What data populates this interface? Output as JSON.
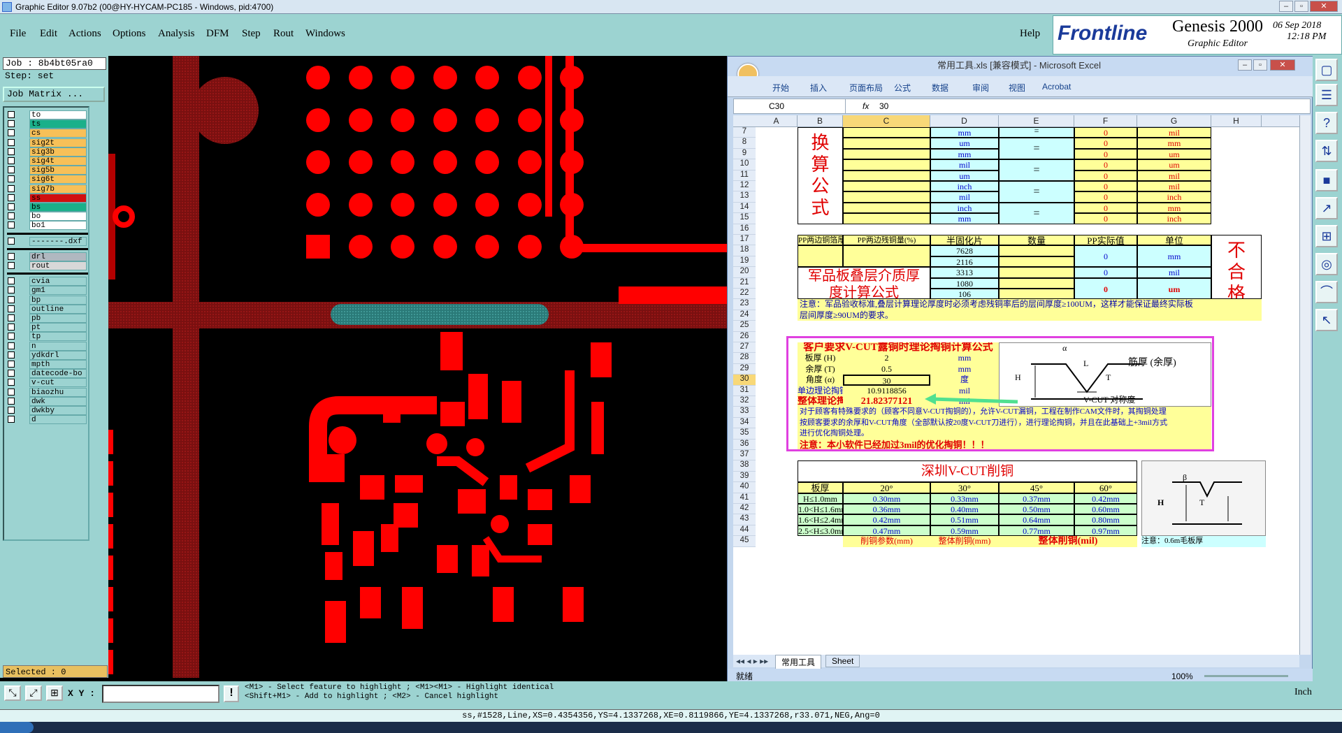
{
  "window": {
    "title": "Graphic Editor 9.07b2 (00@HY-HYCAM-PC185 - Windows, pid:4700)",
    "min": "–",
    "max": "▫",
    "close": "✕"
  },
  "menu": {
    "items": [
      "File",
      "Edit",
      "Actions",
      "Options",
      "Analysis",
      "DFM",
      "Step",
      "Rout",
      "Windows"
    ],
    "help": "Help"
  },
  "brand": {
    "logo": "Frontline",
    "product": "Genesis 2000",
    "subtitle": "Graphic Editor",
    "date": "06 Sep 2018",
    "time": "12:18 PM"
  },
  "job": {
    "job": "Job : 8b4bt05ra0",
    "step": "Step: set",
    "matrix_button": "Job Matrix ..."
  },
  "layers": [
    {
      "name": "to",
      "color": "#ffffff"
    },
    {
      "name": "ts",
      "color": "#1ab08a"
    },
    {
      "name": "cs",
      "color": "#f7c058"
    },
    {
      "name": "sig2t",
      "color": "#f7c058"
    },
    {
      "name": "sig3b",
      "color": "#f7c058"
    },
    {
      "name": "sig4t",
      "color": "#f7c058"
    },
    {
      "name": "sig5b",
      "color": "#f7c058"
    },
    {
      "name": "sig6t",
      "color": "#f7c058"
    },
    {
      "name": "sig7b",
      "color": "#f7c058"
    },
    {
      "name": "ss",
      "color": "#d01010"
    },
    {
      "name": "bs",
      "color": "#1ab08a"
    },
    {
      "name": "bo",
      "color": "#ffffff"
    },
    {
      "name": "bo1",
      "color": "#ffffff"
    }
  ],
  "layers_doc": [
    {
      "name": "-------.dxf",
      "color": "#9cd3d1"
    }
  ],
  "layers_drill": [
    {
      "name": "drl",
      "color": "#b0b8c0"
    },
    {
      "name": "rout",
      "color": "#d8d8d8"
    }
  ],
  "layers_misc": [
    "cvia",
    "gm1",
    "bp",
    "outline",
    "pb",
    "pt",
    "tp",
    "n",
    "ydkdrl",
    "mpth",
    "datecode-bo",
    "v-cut",
    "biaozhu",
    "dwk",
    "dwkby",
    "d"
  ],
  "selected": "Selected : 0",
  "xy": {
    "label": "X Y :",
    "value": ""
  },
  "hints": {
    "line1": "<M1> - Select feature to highlight ; <M1><M1> - Highlight identical",
    "line2": "<Shift+M1> - Add to highlight ; <M2> - Cancel highlight"
  },
  "units": "Inch",
  "status": "ss,#1528,Line,XS=0.4354356,YS=4.1337268,XE=0.8119866,YE=4.1337268,r33.071,NEG,Ang=0",
  "excel": {
    "title": "常用工具.xls  [兼容模式] - Microsoft Excel",
    "tabs": [
      "开始",
      "插入",
      "页面布局",
      "公式",
      "数据",
      "审阅",
      "视图",
      "Acrobat"
    ],
    "namebox": "C30",
    "fx": "fx",
    "formula_value": "30",
    "columns": [
      "A",
      "B",
      "C",
      "D",
      "E",
      "F",
      "G",
      "H"
    ],
    "rows": [
      "7",
      "8",
      "9",
      "10",
      "11",
      "12",
      "13",
      "14",
      "15",
      "16",
      "17",
      "18",
      "19",
      "20",
      "21",
      "22",
      "23",
      "24",
      "25",
      "26",
      "27",
      "28",
      "29",
      "30",
      "31",
      "32",
      "33",
      "34",
      "35",
      "36",
      "37",
      "38",
      "39",
      "40",
      "41",
      "42",
      "43",
      "44",
      "45"
    ],
    "conv_title": [
      "换",
      "算",
      "公",
      "式"
    ],
    "conv": [
      {
        "d": "mm",
        "e": "=",
        "f": "0",
        "g": "mil"
      },
      {
        "d": "um",
        "e": "",
        "f": "0",
        "g": "mm"
      },
      {
        "d": "mm",
        "e": "",
        "f": "0",
        "g": "um"
      },
      {
        "d": "mil",
        "e": "",
        "f": "0",
        "g": "um"
      },
      {
        "d": "um",
        "e": "",
        "f": "0",
        "g": "mil"
      },
      {
        "d": "inch",
        "e": "",
        "f": "0",
        "g": "mil"
      },
      {
        "d": "mil",
        "e": "",
        "f": "0",
        "g": "inch"
      },
      {
        "d": "inch",
        "e": "",
        "f": "0",
        "g": "mm"
      },
      {
        "d": "mm",
        "e": "",
        "f": "0",
        "g": "inch"
      }
    ],
    "eq": "=",
    "pp_headers": [
      "PP两边铜箔厚(mm)",
      "PP两边残铜量(%)",
      "半固化片",
      "数量",
      "PP实际值",
      "单位"
    ],
    "pp_types": [
      "7628",
      "2116",
      "3313",
      "1080",
      "106"
    ],
    "pp_units": [
      "mm",
      "mil",
      "um"
    ],
    "pp_zero": "0",
    "pp_title": "军品板叠层介质厚度计算公式",
    "pp_fail": [
      "不",
      "合",
      "格"
    ],
    "note23": "注意：军品验收标准,叠层计算理论厚度时必须考虑残铜率后的层间厚度≥100UM，这样才能保证最终实际板",
    "note24": "层间厚度≥90UM的要求。",
    "vcut_title": "客户要求V-CUT露铜时理论掏铜计算公式",
    "vcut_rows": [
      {
        "label": "板厚 (H)",
        "value": "2",
        "unit": "mm"
      },
      {
        "label": "余厚 (T)",
        "value": "0.5",
        "unit": "mm"
      },
      {
        "label": "角度 (α)",
        "value": "30",
        "unit": "度"
      },
      {
        "label": "单边理论掏铜",
        "value": "10.9118856",
        "unit": "mil"
      },
      {
        "label": "整体理论掏铜",
        "value": "21.82377121",
        "unit": "mil"
      }
    ],
    "vcut_diag": {
      "alpha": "α",
      "L": "L",
      "T": "T",
      "H": "H",
      "rem": "筋厚 (余厚)",
      "sym": "V-CUT 对称度"
    },
    "vcut_note1": "对于顾客有特殊要求的（顾客不同意V-CUT掏铜的），允许V-CUT漏铜，工程在制作CAM文件时，其掏铜处理",
    "vcut_note2": "按顾客要求的余厚和V-CUT角度（全部默认按20度V-CUT刀进行），进行理论掏铜，并且在此基础上+3mil方式",
    "vcut_note3": "进行优化掏铜处理。",
    "vcut_note4": "注意：本小软件已经加过3mil的优化掏铜！！！",
    "sz_title": "深圳V-CUT削铜",
    "sz_headers": [
      "板厚",
      "20°",
      "30°",
      "45°",
      "60°"
    ],
    "sz_rows": [
      [
        "H≤1.0mm",
        "0.30mm",
        "0.33mm",
        "0.37mm",
        "0.42mm"
      ],
      [
        "1.0<H≤1.6mm",
        "0.36mm",
        "0.40mm",
        "0.50mm",
        "0.60mm"
      ],
      [
        "1.6<H≤2.4mm",
        "0.42mm",
        "0.51mm",
        "0.64mm",
        "0.80mm"
      ],
      [
        "2.5<H≤3.0mm",
        "0.47mm",
        "0.59mm",
        "0.77mm",
        "0.97mm"
      ]
    ],
    "sz_r45": [
      "削铜参数(mm)",
      "整体削铜(mm)",
      "整体削铜(mil)"
    ],
    "sz_diag": {
      "beta": "β",
      "H": "H",
      "T": "T"
    },
    "sz_note": "注意：0.6m毛板厚",
    "sheet_tabs": [
      "常用工具",
      "Sheet"
    ],
    "ready": "就绪",
    "zoom": "100%"
  }
}
